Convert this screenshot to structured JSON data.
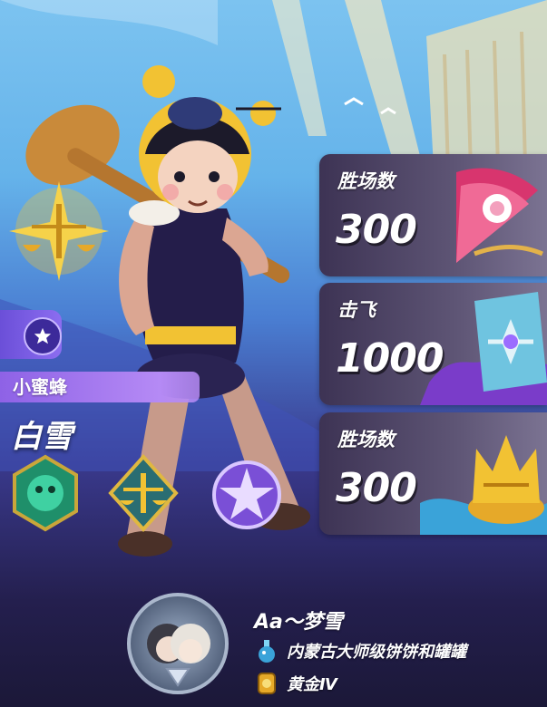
{
  "character": {
    "skin_name": "小蜜蜂",
    "player_title": "白雪",
    "tier_icon": "star-icon",
    "emblems": [
      "dragon-emblem-icon",
      "scales-emblem-icon",
      "star-crest-emblem-icon"
    ]
  },
  "stats": [
    {
      "label": "胜场数",
      "value": "300",
      "art": "fan-icon"
    },
    {
      "label": "击飞",
      "value": "1000",
      "art": "shield-icon"
    },
    {
      "label": "胜场数",
      "value": "300",
      "art": "crown-icon"
    }
  ],
  "owner": {
    "name": "Aa～梦雪",
    "guild": "内蒙古大师级饼饼和罐罐",
    "guild_icon": "potion-icon",
    "rank": "黄金Ⅳ",
    "rank_icon": "gold-medal-icon"
  },
  "colors": {
    "name_tag": "#a87bf0",
    "card_bg": "#4a4062",
    "gold": "#f2c233",
    "purple": "#7a4fd6"
  }
}
